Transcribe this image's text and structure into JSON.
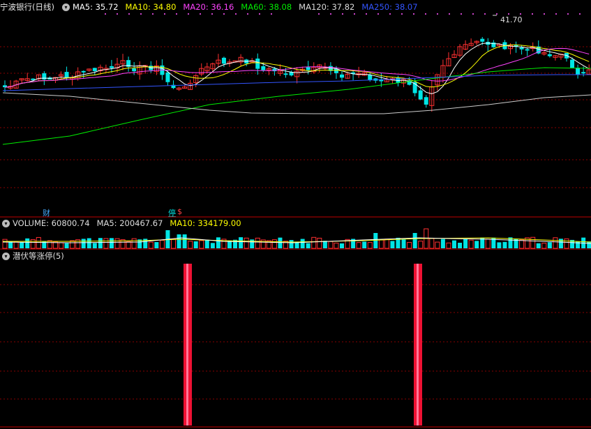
{
  "main": {
    "title": "宁波银行(日线)",
    "ma_legend": [
      {
        "label": "MA5: 35.72",
        "color": "#ffffff"
      },
      {
        "label": "MA10: 34.80",
        "color": "#ffff00"
      },
      {
        "label": "MA20: 36.16",
        "color": "#ff44ff"
      },
      {
        "label": "MA60: 38.08",
        "color": "#00ee00"
      },
      {
        "label": "MA120: 37.82",
        "color": "#dddddd"
      },
      {
        "label": "MA250: 38.07",
        "color": "#3355ff"
      }
    ],
    "high_label": "41.70",
    "markers": [
      {
        "text": "财",
        "color": "#44aaff"
      },
      {
        "text": "停",
        "color": "#00dddd"
      },
      {
        "text": "$",
        "color": "#ff4444"
      }
    ]
  },
  "volume": {
    "label": "VOLUME: 60800.74",
    "ma5": "MA5: 200467.67",
    "ma10": "MA10: 334179.00",
    "colors": {
      "label": "#dddddd",
      "ma5": "#dddddd",
      "ma10": "#ffff00"
    }
  },
  "indicator": {
    "title": "潜伏等涨停(5)",
    "signal_color": "#ee1133"
  },
  "colors": {
    "up": "#ff3030",
    "down": "#00e5e5",
    "grid": "#8a0000"
  }
}
